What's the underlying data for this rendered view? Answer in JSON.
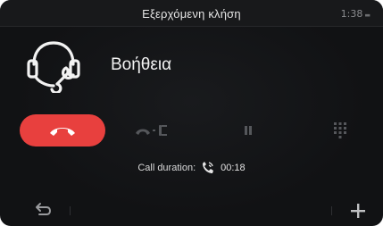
{
  "status_bar": {
    "title": "Εξερχόμενη κλήση",
    "clock": "1:38"
  },
  "contact": {
    "name": "Βοήθεια",
    "icon": "headset-wrench-icon"
  },
  "controls": {
    "hangup_icon": "phone-hangup-icon",
    "handset_icon": "handset-transfer-icon",
    "pause_icon": "pause-icon",
    "keypad_icon": "keypad-icon"
  },
  "call_info": {
    "duration_label": "Call duration:",
    "duration_value": "00:18",
    "duration_icon": "phone-call-icon"
  },
  "bottom_bar": {
    "back_icon": "back-arrow-icon",
    "add_icon": "plus-icon"
  },
  "colors": {
    "background": "#111214",
    "hangup": "#e8403e",
    "inactive_icon": "#55575b"
  }
}
